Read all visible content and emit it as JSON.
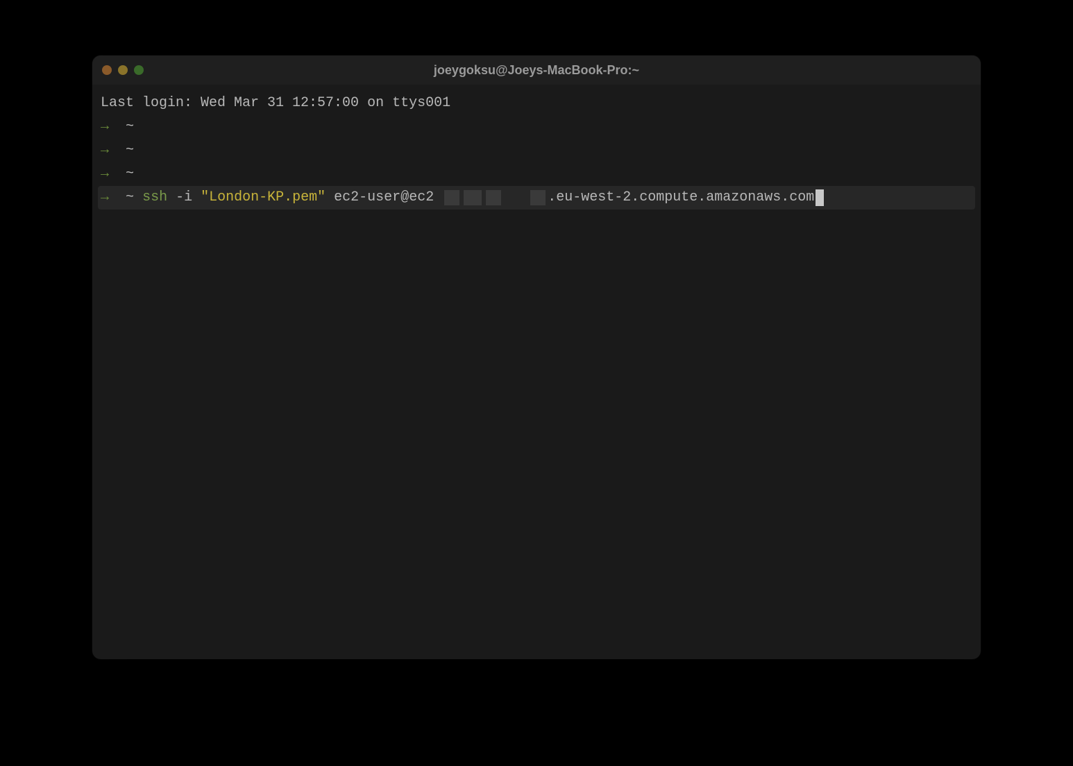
{
  "window": {
    "title": "joeygoksu@Joeys-MacBook-Pro:~"
  },
  "terminal": {
    "last_login": "Last login: Wed Mar 31 12:57:00 on ttys001",
    "arrow": "→",
    "tilde": "~",
    "cmd": {
      "ssh": "ssh",
      "flag": "-i",
      "str": "\"London-KP.pem\"",
      "host_prefix": "ec2-user@ec2",
      "host_suffix": ".eu-west-2.compute.amazonaws.com"
    }
  },
  "colors": {
    "bg": "#1a1a1a",
    "text": "#b8b8b8",
    "arrow": "#6a8a3a",
    "ssh": "#7a9a4a",
    "string": "#c8b43a"
  }
}
